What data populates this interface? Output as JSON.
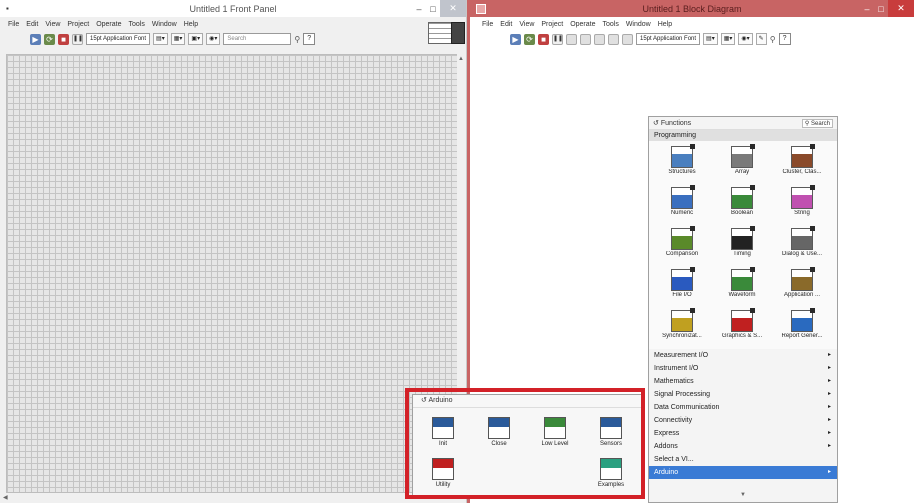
{
  "front_panel": {
    "title": "Untitled 1 Front Panel",
    "app_icon": "labview-vi-icon",
    "menus": [
      "File",
      "Edit",
      "View",
      "Project",
      "Operate",
      "Tools",
      "Window",
      "Help"
    ],
    "font": "15pt Application Font",
    "search_placeholder": "Search",
    "help_label": "?"
  },
  "block_diagram": {
    "title": "Untitled 1 Block Diagram",
    "menus": [
      "File",
      "Edit",
      "View",
      "Project",
      "Operate",
      "Tools",
      "Window",
      "Help"
    ],
    "font": "15pt Application Font",
    "help_label": "?"
  },
  "functions_palette": {
    "title": "Functions",
    "search_label": "Search",
    "category": "Programming",
    "subpalettes": [
      {
        "label": "Structures",
        "icon": "structures-icon",
        "color": "#4a7fbf"
      },
      {
        "label": "Array",
        "icon": "array-icon",
        "color": "#7a7a7a"
      },
      {
        "label": "Cluster, Clas...",
        "icon": "cluster-icon",
        "color": "#8a4a2a"
      },
      {
        "label": "Numeric",
        "icon": "numeric-icon",
        "color": "#3a6fbf"
      },
      {
        "label": "Boolean",
        "icon": "boolean-icon",
        "color": "#3a8a3a"
      },
      {
        "label": "String",
        "icon": "string-icon",
        "color": "#c050b0"
      },
      {
        "label": "Comparison",
        "icon": "comparison-icon",
        "color": "#5a8a2a"
      },
      {
        "label": "Timing",
        "icon": "timing-icon",
        "color": "#222222"
      },
      {
        "label": "Dialog & Use...",
        "icon": "dialog-icon",
        "color": "#666666"
      },
      {
        "label": "File I/O",
        "icon": "file-io-icon",
        "color": "#2a5abf"
      },
      {
        "label": "Waveform",
        "icon": "waveform-icon",
        "color": "#3a8a3a"
      },
      {
        "label": "Application ...",
        "icon": "application-control-icon",
        "color": "#8a6a2a"
      },
      {
        "label": "Synchronizat...",
        "icon": "synchronization-icon",
        "color": "#c0a020"
      },
      {
        "label": "Graphics & S...",
        "icon": "graphics-sound-icon",
        "color": "#c02020"
      },
      {
        "label": "Report Gener...",
        "icon": "report-generation-icon",
        "color": "#2a6abf"
      }
    ],
    "categories": [
      {
        "label": "Measurement I/O",
        "selected": false
      },
      {
        "label": "Instrument I/O",
        "selected": false
      },
      {
        "label": "Mathematics",
        "selected": false
      },
      {
        "label": "Signal Processing",
        "selected": false
      },
      {
        "label": "Data Communication",
        "selected": false
      },
      {
        "label": "Connectivity",
        "selected": false
      },
      {
        "label": "Express",
        "selected": false
      },
      {
        "label": "Addons",
        "selected": false
      },
      {
        "label": "Select a VI...",
        "selected": false
      },
      {
        "label": "Arduino",
        "selected": true
      }
    ]
  },
  "arduino_palette": {
    "title": "Arduino",
    "items": [
      {
        "label": "Init",
        "icon": "arduino-init-icon",
        "color": "#2a5a9a"
      },
      {
        "label": "Close",
        "icon": "arduino-close-icon",
        "color": "#2a5a9a"
      },
      {
        "label": "Low Level",
        "icon": "low-level-icon",
        "color": "#3a8a3a"
      },
      {
        "label": "Sensors",
        "icon": "sensors-icon",
        "color": "#2a5a9a"
      },
      {
        "label": "Utility",
        "icon": "utility-icon",
        "color": "#c02020"
      },
      {
        "label": "Examples",
        "icon": "examples-icon",
        "color": "#2aa080"
      }
    ]
  },
  "highlight_color": "#d32128"
}
